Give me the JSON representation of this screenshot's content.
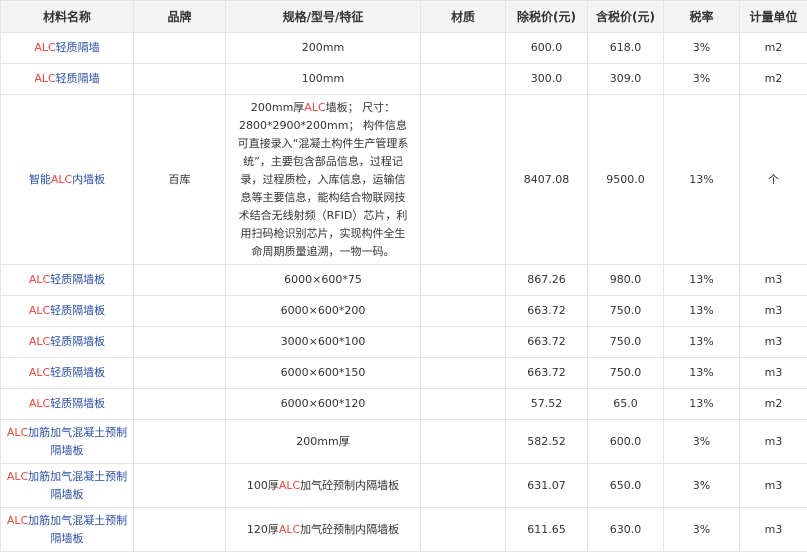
{
  "headers": [
    "材料名称",
    "品牌",
    "规格/型号/特征",
    "材质",
    "除税价(元)",
    "含税价(元)",
    "税率",
    "计量单位"
  ],
  "rows": [
    {
      "name_pre": "",
      "name_hl": "ALC",
      "name_post": "轻质隔墙",
      "brand": "",
      "spec_pre": "200mm",
      "spec_hl": "",
      "spec_post": "",
      "material": "",
      "pre_tax": "600.0",
      "with_tax": "618.0",
      "rate": "3%",
      "unit": "m2"
    },
    {
      "name_pre": "",
      "name_hl": "ALC",
      "name_post": "轻质隔墙",
      "brand": "",
      "spec_pre": "100mm",
      "spec_hl": "",
      "spec_post": "",
      "material": "",
      "pre_tax": "300.0",
      "with_tax": "309.0",
      "rate": "3%",
      "unit": "m2"
    },
    {
      "name_pre": "智能",
      "name_hl": "ALC",
      "name_post": "内墙板",
      "brand": "百库",
      "spec_pre": "200mm厚",
      "spec_hl": "ALC",
      "spec_post": "墙板； 尺寸：2800*2900*200mm； 构件信息可直接录入“混凝土构件生产管理系统”，主要包含部品信息，过程记录，过程质检，入库信息，运输信息等主要信息，能构结合物联网技术结合无线射频（RFID）芯片，利用扫码枪识别芯片，实现构件全生命周期质量追溯，一物一码。",
      "material": "",
      "pre_tax": "8407.08",
      "with_tax": "9500.0",
      "rate": "13%",
      "unit": "个"
    },
    {
      "name_pre": "",
      "name_hl": "ALC",
      "name_post": "轻质隔墙板",
      "brand": "",
      "spec_pre": "6000×600*75",
      "spec_hl": "",
      "spec_post": "",
      "material": "",
      "pre_tax": "867.26",
      "with_tax": "980.0",
      "rate": "13%",
      "unit": "m3"
    },
    {
      "name_pre": "",
      "name_hl": "ALC",
      "name_post": "轻质隔墙板",
      "brand": "",
      "spec_pre": "6000×600*200",
      "spec_hl": "",
      "spec_post": "",
      "material": "",
      "pre_tax": "663.72",
      "with_tax": "750.0",
      "rate": "13%",
      "unit": "m3"
    },
    {
      "name_pre": "",
      "name_hl": "ALC",
      "name_post": "轻质隔墙板",
      "brand": "",
      "spec_pre": "3000×600*100",
      "spec_hl": "",
      "spec_post": "",
      "material": "",
      "pre_tax": "663.72",
      "with_tax": "750.0",
      "rate": "13%",
      "unit": "m3"
    },
    {
      "name_pre": "",
      "name_hl": "ALC",
      "name_post": "轻质隔墙板",
      "brand": "",
      "spec_pre": "6000×600*150",
      "spec_hl": "",
      "spec_post": "",
      "material": "",
      "pre_tax": "663.72",
      "with_tax": "750.0",
      "rate": "13%",
      "unit": "m3"
    },
    {
      "name_pre": "",
      "name_hl": "ALC",
      "name_post": "轻质隔墙板",
      "brand": "",
      "spec_pre": "6000×600*120",
      "spec_hl": "",
      "spec_post": "",
      "material": "",
      "pre_tax": "57.52",
      "with_tax": "65.0",
      "rate": "13%",
      "unit": "m2"
    },
    {
      "name_pre": "",
      "name_hl": "ALC",
      "name_post": "加筋加气混凝土预制隔墙板",
      "brand": "",
      "spec_pre": "200mm厚",
      "spec_hl": "",
      "spec_post": "",
      "material": "",
      "pre_tax": "582.52",
      "with_tax": "600.0",
      "rate": "3%",
      "unit": "m3"
    },
    {
      "name_pre": "",
      "name_hl": "ALC",
      "name_post": "加筋加气混凝土预制隔墙板",
      "brand": "",
      "spec_pre": "100厚",
      "spec_hl": "ALC",
      "spec_post": "加气砼预制内隔墙板",
      "material": "",
      "pre_tax": "631.07",
      "with_tax": "650.0",
      "rate": "3%",
      "unit": "m3"
    },
    {
      "name_pre": "",
      "name_hl": "ALC",
      "name_post": "加筋加气混凝土预制隔墙板",
      "brand": "",
      "spec_pre": "120厚",
      "spec_hl": "ALC",
      "spec_post": "加气砼预制内隔墙板",
      "material": "",
      "pre_tax": "611.65",
      "with_tax": "630.0",
      "rate": "3%",
      "unit": "m3"
    }
  ],
  "colors": {
    "highlight": "#e5473d",
    "name_text": "#2b4fa3",
    "header_bg": "#f4f4f4",
    "border": "#e4e4e4"
  }
}
